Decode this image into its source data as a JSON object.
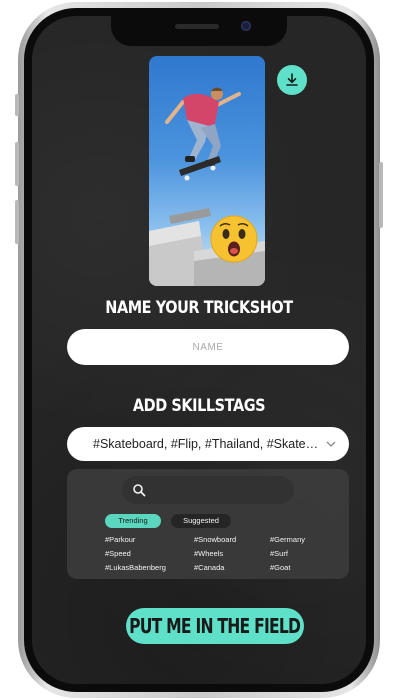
{
  "header": {
    "title": "NAME YOUR TRICKSHOT",
    "skills_title": "ADD SKILLSTAGS"
  },
  "name_input": {
    "placeholder": "NAME",
    "value": ""
  },
  "skills_select": {
    "value": "#Skateboard, #Flip, #Thailand, #Skateboarding"
  },
  "tag_search": {
    "placeholder": ""
  },
  "tag_tabs": [
    {
      "label": "Trending",
      "active": true
    },
    {
      "label": "Suggested",
      "active": false
    }
  ],
  "tags": [
    "#Parkour",
    "#Snowboard",
    "#Germany",
    "#Speed",
    "#Wheels",
    "#Surf",
    "#LukasBabenberg",
    "#Canada",
    "#Goat"
  ],
  "cta": {
    "label": "PUT ME IN THE FIELD"
  },
  "icons": {
    "download": "download-icon",
    "search": "search-icon",
    "dropdown": "chevron-down-icon",
    "reaction": "surprised-emoji-icon"
  },
  "colors": {
    "accent": "#5fe0c8",
    "background": "#262626",
    "panel": "#3b3b3b",
    "text_light": "#ffffff"
  }
}
